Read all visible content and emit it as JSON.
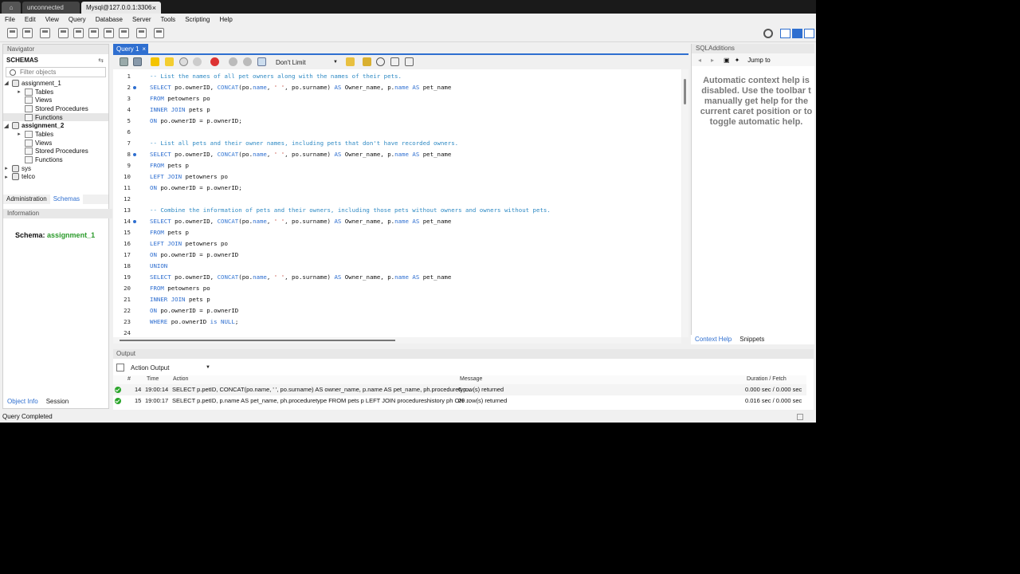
{
  "window": {
    "tabs": [
      {
        "label": "unconnected"
      },
      {
        "label": "Mysql@127.0.0.1:3306"
      }
    ],
    "close_glyph": "×"
  },
  "menu": [
    "File",
    "Edit",
    "View",
    "Query",
    "Database",
    "Server",
    "Tools",
    "Scripting",
    "Help"
  ],
  "navigator": {
    "header": "Navigator",
    "schemas_title": "SCHEMAS",
    "filter_placeholder": "Filter objects",
    "tree": {
      "assignment_1": {
        "name": "assignment_1",
        "children": [
          "Tables",
          "Views",
          "Stored Procedures",
          "Functions"
        ]
      },
      "assignment_2": {
        "name": "assignment_2",
        "children": [
          "Tables",
          "Views",
          "Stored Procedures",
          "Functions"
        ]
      },
      "sys": "sys",
      "telco": "telco"
    },
    "tabs": [
      "Administration",
      "Schemas"
    ],
    "info_header": "Information",
    "schema_label": "Schema:",
    "schema_value": "assignment_1",
    "bottom_tabs": [
      "Object Info",
      "Session"
    ]
  },
  "editor": {
    "tab_label": "Query 1",
    "limit_label": "Don't Limit",
    "lines": [
      {
        "n": "1",
        "dot": false,
        "parts": [
          [
            "cm",
            "-- List the names of all pet owners along with the names of their pets."
          ]
        ]
      },
      {
        "n": "2",
        "dot": true,
        "parts": [
          [
            "kw",
            "SELECT"
          ],
          [
            "tx",
            " po.ownerID, "
          ],
          [
            "fn",
            "CONCAT"
          ],
          [
            "tx",
            "(po."
          ],
          [
            "kw",
            "name"
          ],
          [
            "tx",
            ", "
          ],
          [
            "str",
            "' '"
          ],
          [
            "tx",
            ", po.surname) "
          ],
          [
            "kw",
            "AS"
          ],
          [
            "tx",
            " Owner_name, p."
          ],
          [
            "kw",
            "name"
          ],
          [
            "tx",
            " "
          ],
          [
            "kw",
            "AS"
          ],
          [
            "tx",
            " pet_name"
          ]
        ]
      },
      {
        "n": "3",
        "dot": false,
        "parts": [
          [
            "kw",
            "FROM"
          ],
          [
            "tx",
            " petowners po"
          ]
        ]
      },
      {
        "n": "4",
        "dot": false,
        "parts": [
          [
            "kw",
            "INNER JOIN"
          ],
          [
            "tx",
            " pets p"
          ]
        ]
      },
      {
        "n": "5",
        "dot": false,
        "parts": [
          [
            "kw",
            "ON"
          ],
          [
            "tx",
            " po.ownerID = p.ownerID;"
          ]
        ]
      },
      {
        "n": "6",
        "dot": false,
        "parts": []
      },
      {
        "n": "7",
        "dot": false,
        "parts": [
          [
            "cm",
            "-- List all pets and their owner names, including pets that don't have recorded owners."
          ]
        ]
      },
      {
        "n": "8",
        "dot": true,
        "parts": [
          [
            "kw",
            "SELECT"
          ],
          [
            "tx",
            " po.ownerID, "
          ],
          [
            "fn",
            "CONCAT"
          ],
          [
            "tx",
            "(po."
          ],
          [
            "kw",
            "name"
          ],
          [
            "tx",
            ", "
          ],
          [
            "str",
            "' '"
          ],
          [
            "tx",
            ", po.surname) "
          ],
          [
            "kw",
            "AS"
          ],
          [
            "tx",
            " Owner_name, p."
          ],
          [
            "kw",
            "name"
          ],
          [
            "tx",
            " "
          ],
          [
            "kw",
            "AS"
          ],
          [
            "tx",
            " pet_name"
          ]
        ]
      },
      {
        "n": "9",
        "dot": false,
        "parts": [
          [
            "kw",
            "FROM"
          ],
          [
            "tx",
            " pets p"
          ]
        ]
      },
      {
        "n": "10",
        "dot": false,
        "parts": [
          [
            "kw",
            "LEFT JOIN"
          ],
          [
            "tx",
            " petowners po"
          ]
        ]
      },
      {
        "n": "11",
        "dot": false,
        "parts": [
          [
            "kw",
            "ON"
          ],
          [
            "tx",
            " po.ownerID = p.ownerID;"
          ]
        ]
      },
      {
        "n": "12",
        "dot": false,
        "parts": []
      },
      {
        "n": "13",
        "dot": false,
        "parts": [
          [
            "cm",
            "-- Combine the information of pets and their owners, including those pets without owners and owners without pets."
          ]
        ]
      },
      {
        "n": "14",
        "dot": true,
        "parts": [
          [
            "kw",
            "SELECT"
          ],
          [
            "tx",
            " po.ownerID, "
          ],
          [
            "fn",
            "CONCAT"
          ],
          [
            "tx",
            "(po."
          ],
          [
            "kw",
            "name"
          ],
          [
            "tx",
            ", "
          ],
          [
            "str",
            "' '"
          ],
          [
            "tx",
            ", po.surname) "
          ],
          [
            "kw",
            "AS"
          ],
          [
            "tx",
            " Owner_name, p."
          ],
          [
            "kw",
            "name"
          ],
          [
            "tx",
            " "
          ],
          [
            "kw",
            "AS"
          ],
          [
            "tx",
            " pet_name"
          ]
        ]
      },
      {
        "n": "15",
        "dot": false,
        "parts": [
          [
            "kw",
            "FROM"
          ],
          [
            "tx",
            " pets p"
          ]
        ]
      },
      {
        "n": "16",
        "dot": false,
        "parts": [
          [
            "kw",
            "LEFT JOIN"
          ],
          [
            "tx",
            " petowners po"
          ]
        ]
      },
      {
        "n": "17",
        "dot": false,
        "parts": [
          [
            "kw",
            "ON"
          ],
          [
            "tx",
            " po.ownerID = p.ownerID"
          ]
        ]
      },
      {
        "n": "18",
        "dot": false,
        "parts": [
          [
            "kw",
            "UNION"
          ]
        ]
      },
      {
        "n": "19",
        "dot": false,
        "parts": [
          [
            "kw",
            "SELECT"
          ],
          [
            "tx",
            " po.ownerID, "
          ],
          [
            "fn",
            "CONCAT"
          ],
          [
            "tx",
            "(po."
          ],
          [
            "kw",
            "name"
          ],
          [
            "tx",
            ", "
          ],
          [
            "str",
            "' '"
          ],
          [
            "tx",
            ", po.surname) "
          ],
          [
            "kw",
            "AS"
          ],
          [
            "tx",
            " Owner_name, p."
          ],
          [
            "kw",
            "name"
          ],
          [
            "tx",
            " "
          ],
          [
            "kw",
            "AS"
          ],
          [
            "tx",
            " pet_name"
          ]
        ]
      },
      {
        "n": "20",
        "dot": false,
        "parts": [
          [
            "kw",
            "FROM"
          ],
          [
            "tx",
            " petowners po"
          ]
        ]
      },
      {
        "n": "21",
        "dot": false,
        "parts": [
          [
            "kw",
            "INNER JOIN"
          ],
          [
            "tx",
            " pets p"
          ]
        ]
      },
      {
        "n": "22",
        "dot": false,
        "parts": [
          [
            "kw",
            "ON"
          ],
          [
            "tx",
            " po.ownerID = p.ownerID"
          ]
        ]
      },
      {
        "n": "23",
        "dot": false,
        "parts": [
          [
            "kw",
            "WHERE"
          ],
          [
            "tx",
            " po.ownerID "
          ],
          [
            "kw",
            "is"
          ],
          [
            "tx",
            " "
          ],
          [
            "kw",
            "NULL"
          ],
          [
            "tx",
            ";"
          ]
        ]
      },
      {
        "n": "24",
        "dot": false,
        "parts": []
      }
    ]
  },
  "sql_additions": {
    "header": "SQLAdditions",
    "jump_label": "Jump to",
    "help_text": "Automatic context help is\ndisabled. Use the toolbar t\nmanually get help for the\ncurrent caret position or to\ntoggle automatic help.",
    "tabs": [
      "Context Help",
      "Snippets"
    ]
  },
  "output": {
    "header": "Output",
    "selector": "Action Output",
    "columns": [
      "#",
      "Time",
      "Action",
      "Message",
      "Duration / Fetch"
    ],
    "rows": [
      {
        "num": "14",
        "time": "19:00:14",
        "action": "SELECT p.petID, CONCAT(po.name, ' ', po.surname) AS owner_name, p.name AS pet_name, ph.proceduretyp...",
        "message": "0 row(s) returned",
        "duration": "0.000 sec / 0.000 sec"
      },
      {
        "num": "15",
        "time": "19:00:17",
        "action": "SELECT p.petID, p.name AS pet_name, ph.proceduretype FROM pets p LEFT JOIN procedureshistory ph ON ...",
        "message": "29 row(s) returned",
        "duration": "0.016 sec / 0.000 sec"
      }
    ]
  },
  "status": "Query Completed",
  "colors": {
    "accent": "#2f6fd0",
    "success": "#2aa52a",
    "schema_value": "#2a9a2a"
  }
}
